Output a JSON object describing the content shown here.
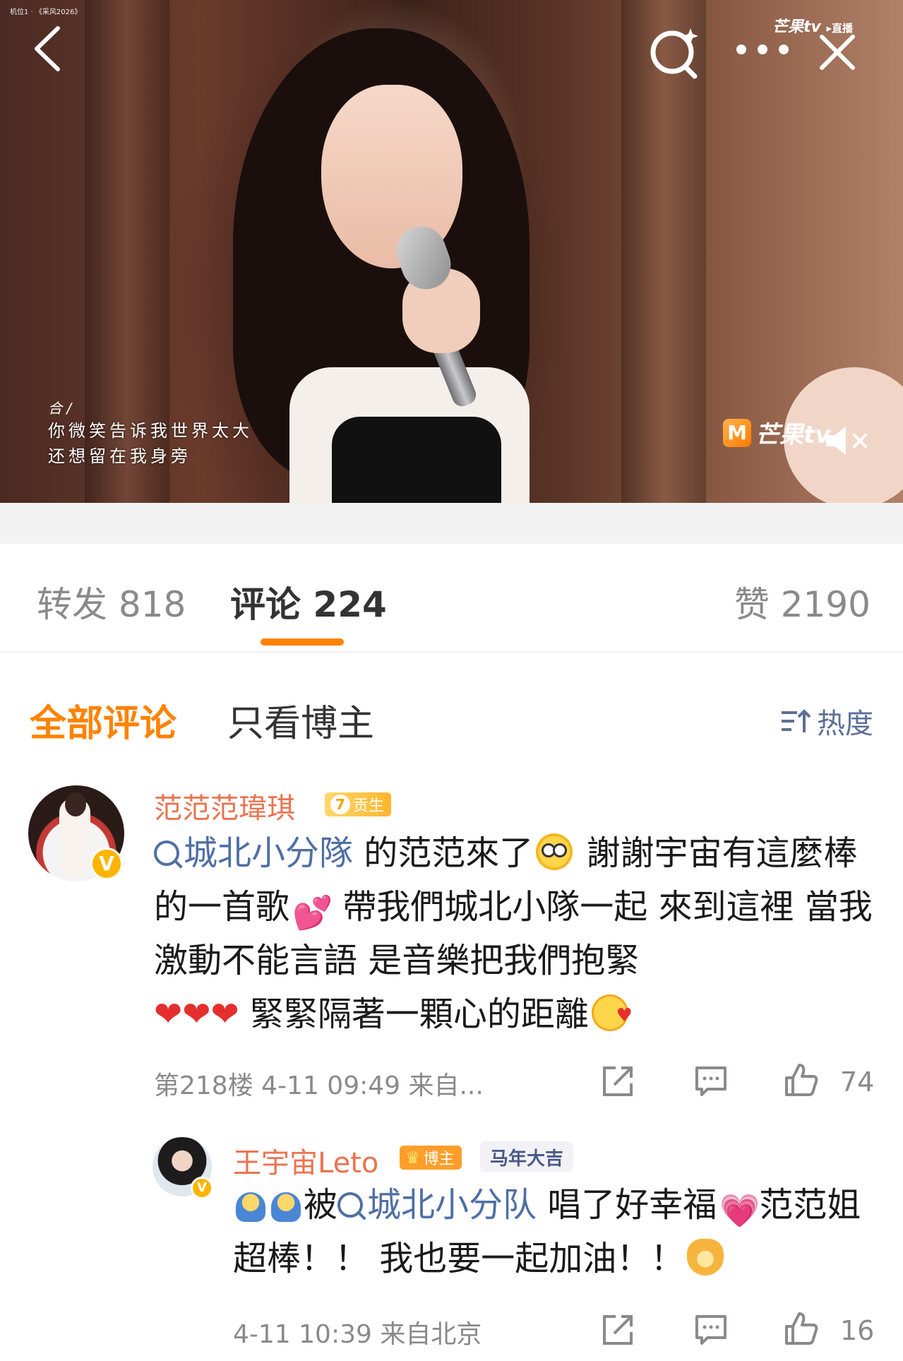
{
  "video": {
    "top_left_small": "机位1 · 《采风2026》",
    "brand_top": "芒果tv",
    "brand_top_live": "▸直播",
    "lyric_tag": "合 /",
    "lyric_line1": "你微笑告诉我世界太大",
    "lyric_line2": "还想留在我身旁",
    "brand_bottom": "芒果tv",
    "brand_bottom_logo": "M",
    "icons": [
      "back-icon",
      "search-icon",
      "more-icon",
      "close-icon",
      "mute-icon"
    ]
  },
  "tabs": {
    "repost": "转发 818",
    "comments": "评论 224",
    "likes": "赞 2190",
    "active": "comments",
    "accent_color": "#ff8200"
  },
  "filter": {
    "all": "全部评论",
    "owner_only": "只看博主",
    "sort_label": "热度"
  },
  "comments": [
    {
      "name": "范范范瑋琪",
      "badge_level": "7",
      "badge_label": "贡生",
      "verified": "V",
      "topic": "城北小分隊",
      "text_a": " 的范范來了",
      "text_b": " 謝謝宇宙有這麼棒的一首歌",
      "text_c": " 帶我們城北小隊一起 來到這裡 當我激動不能言語 是音樂把我們抱緊",
      "hearts": "❤❤❤",
      "text_d": " 緊緊隔著一顆心的距離",
      "meta": "第218楼  4-11 09:49  来自...",
      "likes": "74"
    },
    {
      "name": "王宇宙Leto",
      "badge_label": "博主",
      "badge_crown": "♛",
      "horse_badge": "马年大吉",
      "verified": "V",
      "text_a": "被",
      "topic": "城北小分队",
      "text_b": " 唱了好幸福",
      "text_c": "范范姐超棒！！ 我也要一起加油！！",
      "meta": "4-11 10:39  来自北京",
      "likes": "16"
    }
  ]
}
